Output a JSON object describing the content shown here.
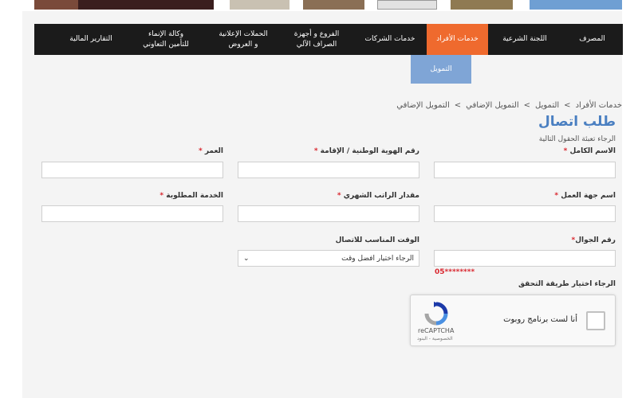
{
  "nav": {
    "items": [
      {
        "label": "المصرف"
      },
      {
        "label": "اللجنة الشرعية"
      },
      {
        "label": "خدمات الأفراد"
      },
      {
        "label": "خدمات الشركات"
      },
      {
        "label": "الفروع و أجهزة\nالصراف الآلي"
      },
      {
        "label": "الحملات الإعلانية\nو العروض"
      },
      {
        "label": "وكالة الإنماء\nللتأمين التعاوني"
      },
      {
        "label": "التقارير المالية"
      }
    ],
    "active_item": "خدمات الأفراد",
    "submenu": {
      "label": "التمويل"
    }
  },
  "breadcrumb": [
    "خدمات الأفراد",
    "التمويل",
    "التمويل الإضافي",
    "التمويل الإضافي"
  ],
  "breadcrumb_separator": ">",
  "page_title": "طلب اتصال",
  "instructions": "الرجاء تعبئة الحقول التالية",
  "required_marker": "*",
  "fields": {
    "full_name": {
      "label": "الاسم الكامل",
      "value": ""
    },
    "national_id": {
      "label": "رقم الهوية الوطنية / الإقامة",
      "value": ""
    },
    "age": {
      "label": "العمر",
      "value": ""
    },
    "employer": {
      "label": "اسم جهة العمل",
      "value": ""
    },
    "salary": {
      "label": "مقدار الراتب الشهري",
      "value": ""
    },
    "service": {
      "label": "الخدمة المطلوبة",
      "value": ""
    },
    "mobile": {
      "label": "رقم الجوال",
      "value": "",
      "hint": "05********"
    },
    "contact_time": {
      "label": "الوقت المناسب للاتصال",
      "selected": "الرجاء اختيار افضل وقت"
    }
  },
  "verification_label": "الرجاء اختيار طريقة التحقق",
  "captcha": {
    "checkbox_label": "أنا لست برنامج روبوت",
    "brand": "reCAPTCHA",
    "links": "الخصوصية - البنود"
  },
  "colors": {
    "nav_bg": "#1b1b1b",
    "nav_active": "#ef6a2e",
    "submenu_bg": "#7fa5d6",
    "title": "#4a7fc1",
    "required": "#d9262e"
  },
  "icons": {
    "select_arrow": "chevron-down-icon",
    "captcha_logo": "recaptcha-logo-icon"
  }
}
